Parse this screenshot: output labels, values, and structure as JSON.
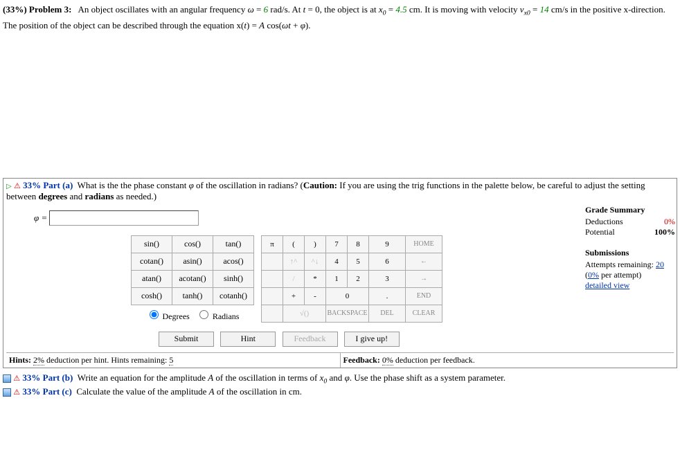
{
  "problem": {
    "weight": "(33%)",
    "label": "Problem 3:",
    "text1": "An object oscillates with an angular frequency ",
    "omega_var": "ω",
    "eq1": " = ",
    "omega_val": "6",
    "text2": " rad/s. At ",
    "t_var": "t",
    "eq2": " = 0, the object is at ",
    "x0_var": "x",
    "x0_sub": "0",
    "eq3": " = ",
    "x0_val": "4.5",
    "text3": " cm. It is moving with velocity ",
    "v_var": "v",
    "vsub": "x0",
    "eq4": " = ",
    "v_val": "14",
    "text4": " cm/s in the positive x-direction. The position of the object can be described through the equation x(",
    "t2": "t",
    "text5": ") = ",
    "A": "A",
    "text6": " cos(",
    "omega2": "ωt",
    "text7": " + ",
    "phi": "φ",
    "text8": ")."
  },
  "part_a": {
    "pct": "33%",
    "label": "Part (a)",
    "q1": "What is the the phase constant ",
    "phi": "φ",
    "q2": " of the oscillation in radians? (",
    "caution": "Caution:",
    "q3": " If you are using the trig functions in the palette below, be careful to adjust the setting between ",
    "deg": "degrees",
    "and": " and ",
    "rad": "radians",
    "q4": " as needed.)",
    "input_label": "φ ="
  },
  "palette": {
    "r1": [
      "sin()",
      "cos()",
      "tan()"
    ],
    "r2": [
      "cotan()",
      "asin()",
      "acos()"
    ],
    "r3": [
      "atan()",
      "acotan()",
      "sinh()"
    ],
    "r4": [
      "cosh()",
      "tanh()",
      "cotanh()"
    ],
    "deg": "Degrees",
    "rad": "Radians"
  },
  "keypad": {
    "r1": [
      "π",
      "(",
      ")",
      "7",
      "8",
      "9",
      "HOME"
    ],
    "r2": [
      "",
      "↑^",
      "^↓",
      "4",
      "5",
      "6",
      "←"
    ],
    "r3": [
      "",
      "/",
      "*",
      "1",
      "2",
      "3",
      "→"
    ],
    "r4": [
      "",
      "+",
      "-",
      "0",
      ".",
      "END"
    ],
    "r5": [
      "",
      "√()",
      "BACKSPACE",
      "DEL",
      "CLEAR"
    ]
  },
  "buttons": {
    "submit": "Submit",
    "hint": "Hint",
    "feedback": "Feedback",
    "giveup": "I give up!"
  },
  "grade": {
    "title": "Grade Summary",
    "ded_l": "Deductions",
    "ded_v": "0%",
    "pot_l": "Potential",
    "pot_v": "100%",
    "sub_title": "Submissions",
    "attempts_l": "Attempts remaining: ",
    "attempts_v": "20",
    "per_l": "(",
    "per_v": "0%",
    "per_e": " per attempt)",
    "detailed": "detailed view"
  },
  "hints": {
    "h_l": "Hints: ",
    "h_pct": "2%",
    "h_mid": " deduction per hint. Hints remaining: ",
    "h_rem": "5",
    "f_l": "Feedback: ",
    "f_pct": "0%",
    "f_e": " deduction per feedback."
  },
  "part_b": {
    "pct": "33%",
    "label": "Part (b)",
    "text1": "Write an equation for the amplitude ",
    "A": "A",
    "text2": " of the oscillation in terms of ",
    "x0": "x",
    "x0sub": "0",
    "and": " and ",
    "phi": "φ",
    "text3": ". Use the phase shift as a system parameter."
  },
  "part_c": {
    "pct": "33%",
    "label": "Part (c)",
    "text1": "Calculate the value of the amplitude ",
    "A": "A",
    "text2": " of the oscillation in cm."
  }
}
